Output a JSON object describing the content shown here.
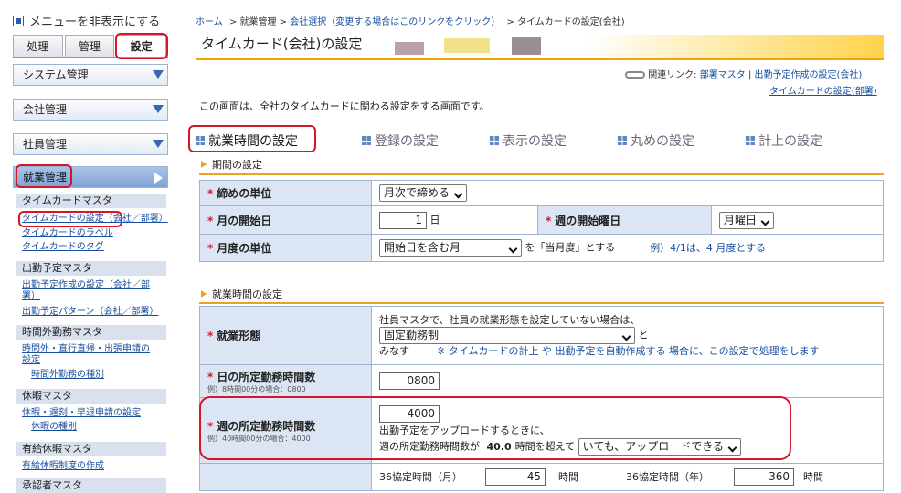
{
  "sidebar": {
    "hide_menu": "メニューを非表示にする",
    "tabs": [
      "処理",
      "管理",
      "設定"
    ],
    "sections": [
      "システム管理",
      "会社管理",
      "社員管理",
      "就業管理"
    ],
    "groups": [
      {
        "title": "タイムカードマスタ",
        "items": [
          "タイムカードの設定（会社／部署）",
          "タイムカードのラベル",
          "タイムカードのタグ"
        ]
      },
      {
        "title": "出勤予定マスタ",
        "items": [
          "出勤予定作成の設定（会社／部署）",
          "出勤予定パターン（会社／部署）"
        ]
      },
      {
        "title": "時間外勤務マスタ",
        "items": [
          "時間外・直行直帰・出張申請の設定",
          "時間外勤務の種別"
        ]
      },
      {
        "title": "休暇マスタ",
        "items": [
          "休暇・遅刻・早退申請の設定",
          "休暇の種別"
        ]
      },
      {
        "title": "有給休暇マスタ",
        "items": [
          "有給休暇制度の作成"
        ]
      },
      {
        "title": "承認者マスタ",
        "items": []
      }
    ]
  },
  "breadcrumb": {
    "home": "ホーム",
    "sep": ">",
    "attendance": "就業管理",
    "company_select": "会社選択（変更する場合はこのリンクをクリック）",
    "current": "タイムカードの設定(会社)"
  },
  "page_title": "タイムカード(会社)の設定",
  "related": {
    "label": "関連リンク:",
    "links": [
      "部署マスタ",
      "出勤予定作成の設定(会社)",
      "タイムカードの設定(部署)"
    ],
    "sep": "|"
  },
  "description": "この画面は、全社のタイムカードに関わる設定をする画面です。",
  "tabs": [
    "就業時間の設定",
    "登録の設定",
    "表示の設定",
    "丸めの設定",
    "計上の設定"
  ],
  "period": {
    "heading": "期間の設定",
    "close_unit_label": "締めの単位",
    "close_unit_value": "月次で締める",
    "month_start_label": "月の開始日",
    "month_start_value": "1",
    "day_suffix": "日",
    "week_start_label": "週の開始曜日",
    "week_start_value": "月曜日",
    "month_unit_label": "月度の単位",
    "month_unit_value": "開始日を含む月",
    "month_unit_suffix": "を「当月度」とする",
    "month_unit_example": "例）4/1は、4 月度とする"
  },
  "work": {
    "heading": "就業時間の設定",
    "form_label": "就業形態",
    "form_text1": "社員マスタで、社員の就業形態を設定していない場合は、",
    "form_value": "固定勤務制",
    "form_to": "と",
    "form_text2": "みなす",
    "form_note": "※ タイムカードの計上 や 出勤予定を自動作成する 場合に、この設定で処理をします",
    "day_label": "日の所定勤務時間数",
    "day_example": "例）8時間00分の場合：0800",
    "day_value": "0800",
    "week_label": "週の所定勤務時間数",
    "week_example": "例）40時間00分の場合：4000",
    "week_value": "4000",
    "week_text1": "出勤予定をアップロードするときに、",
    "week_text2": "週の所定勤務時間数が",
    "week_hours": "40.0",
    "week_text3": "時間を超えて",
    "week_select": "いても、アップロードできる",
    "agree_month_label": "36協定時間（月）",
    "agree_month_value": "45",
    "hour_unit": "時間",
    "agree_year_label": "36協定時間（年）",
    "agree_year_value": "360"
  }
}
